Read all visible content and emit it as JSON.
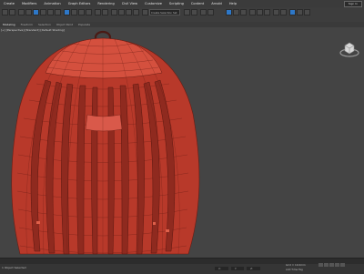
{
  "menu": {
    "items": [
      "Create",
      "Modifiers",
      "Animation",
      "Graph Editors",
      "Rendering",
      "Civil View",
      "Customize",
      "Scripting",
      "Content",
      "Arnold",
      "Help"
    ],
    "signin": "Sign In"
  },
  "toolbar": {
    "selection_set": "Create Selection Set"
  },
  "ribbon": {
    "tabs": [
      "Modeling",
      "Freeform",
      "Selection",
      "Object Paint",
      "Populate"
    ]
  },
  "viewport": {
    "label": "[+] [Perspective] [Standard] [Default Shading]"
  },
  "status": {
    "left_text": "1 Object Selected",
    "x_label": "X:",
    "x_value": "",
    "y_label": "Y:",
    "y_value": "",
    "z_label": "Z:",
    "z_value": "",
    "grid": "Grid = 10.0mm",
    "add_time_tag": "Add Time Tag"
  },
  "colors": {
    "model_fill": "#c0402e",
    "model_wire": "#6a1d14",
    "viewport_bg": "#444444"
  }
}
